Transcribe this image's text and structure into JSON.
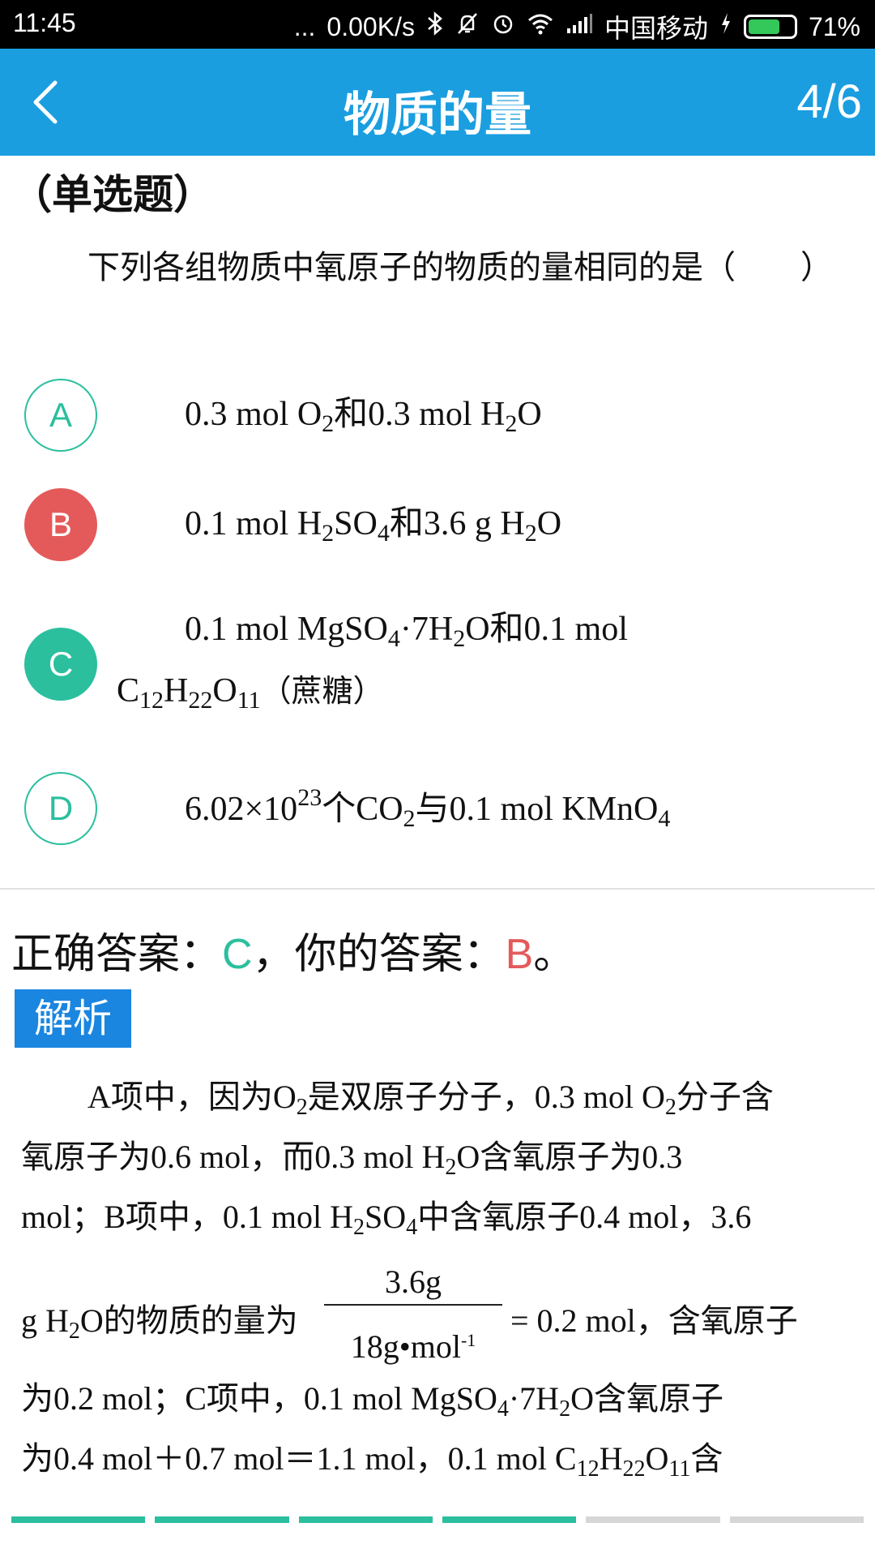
{
  "status_bar": {
    "time": "11:45",
    "dots": "...",
    "net_speed": "0.00K/s",
    "carrier": "中国移动",
    "battery": "71%",
    "battery_level": 0.71,
    "icons": [
      "bluetooth-icon",
      "mute-icon",
      "alarm-icon",
      "wifi-icon",
      "signal-icon",
      "charging-icon",
      "battery-icon"
    ]
  },
  "app_bar": {
    "title": "物质的量",
    "counter": "4/6",
    "back_icon": "chevron-left-icon"
  },
  "question": {
    "type": "（单选题）",
    "stem": "下列各组物质中氧原子的物质的量相同的是（　　）"
  },
  "options": [
    {
      "letter": "A",
      "state": "normal"
    },
    {
      "letter": "B",
      "state": "wrong"
    },
    {
      "letter": "C",
      "state": "correct"
    },
    {
      "letter": "D",
      "state": "normal"
    }
  ],
  "option_texts": {
    "A": [
      "0.3 mol O",
      "2",
      "和0.3 mol H",
      "2",
      "O"
    ],
    "B": [
      "0.1 mol H",
      "2",
      "SO",
      "4",
      "和3.6 g H",
      "2",
      "O"
    ],
    "C": [
      "0.1 mol MgSO",
      "4",
      "·7H",
      "2",
      "O和0.1 mol C",
      "12",
      "H",
      "22",
      "O",
      "11",
      "（蔗糖）"
    ],
    "D": [
      "6.02×10",
      "23",
      "个CO",
      "2",
      "与0.1 mol KMnO",
      "4"
    ]
  },
  "result": {
    "prefix": "正确答案：",
    "correct": "C",
    "middle": "，你的答案：",
    "yours": "B",
    "suffix": "。"
  },
  "analysis": {
    "label": "解析",
    "line1": [
      "A项中，因为O",
      "2",
      "是双原子分子，0.3 mol O",
      "2",
      "分子含"
    ],
    "line2": [
      "氧原子为0.6 mol，而0.3 mol H",
      "2",
      "O含氧原子为0.3"
    ],
    "line3": [
      "mol；B项中，0.1 mol H",
      "2",
      "SO",
      "4",
      "中含氧原子0.4 mol，3.6"
    ],
    "line4_prefix": [
      "g H",
      "2",
      "O的物质的量为"
    ],
    "fraction_num": "3.6g",
    "fraction_den": "18g•mol",
    "fraction_den_exp": "-1",
    "line4_suffix": "= 0.2 mol，含氧原子",
    "line5": [
      "为0.2 mol；C项中，0.1 mol MgSO",
      "4",
      "·7H",
      "2",
      "O含氧原子"
    ],
    "line6": [
      "为0.4 mol＋0.7 mol＝1.1 mol，0.1 mol C",
      "12",
      "H",
      "22",
      "O",
      "11",
      "含"
    ]
  },
  "progress": {
    "total": 6,
    "completed": 4,
    "colors": {
      "done": "#2bbf9e",
      "pending": "#d6d6d6"
    }
  },
  "colors": {
    "app_bar": "#1a9ee0",
    "correct": "#2bbf9e",
    "wrong": "#e45a5a",
    "label_bg": "#1a86e0"
  }
}
